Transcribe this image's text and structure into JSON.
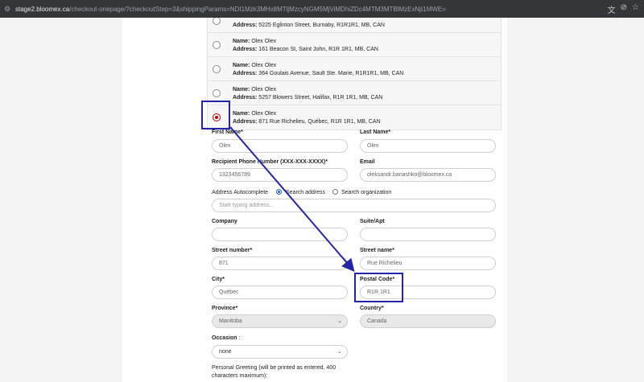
{
  "browser": {
    "url_host": "stage2.bloomex.ca",
    "url_path": "/checkout-onepage/?checkoutStep=3&shippingParams=NDI1Mzk3MHx8MTljMzcyNGM5MjViMDhiZDc4MTM3MTBlMzExNjI1MWE="
  },
  "addresses": [
    {
      "name_label": "",
      "name": "",
      "address_label": "Address:",
      "address": "5225 Eglinton Street, Burnaby, R1R1R1, MB, CAN"
    },
    {
      "name_label": "Name:",
      "name": "Olex Olex",
      "address_label": "Address:",
      "address": "161 Beacon St, Saint John, R1R 1R1, MB, CAN"
    },
    {
      "name_label": "Name:",
      "name": "Olex Olex",
      "address_label": "Address:",
      "address": "364 Goulais Avenue, Sault Ste. Marie, R1R1R1, MB, CAN"
    },
    {
      "name_label": "Name:",
      "name": "Olex Olex",
      "address_label": "Address:",
      "address": "5257 Blowers Street, Halifax, R1R 1R1, MB, CAN"
    },
    {
      "name_label": "Name:",
      "name": "Olex Olex",
      "address_label": "Address:",
      "address": "871 Rue Richelieu, Québec, R1R 1R1, MB, CAN"
    }
  ],
  "form": {
    "first_name_label": "First Name*",
    "first_name": "Olex",
    "last_name_label": "Last Name*",
    "last_name": "Olex",
    "phone_label": "Recipient Phone Number (XXX-XXX-XXXX)*",
    "phone": "1323456789",
    "email_label": "Email",
    "email": "oleksandr.banashko@bloomex.ca",
    "autocomplete_label": "Address Autocomplete",
    "search_address": "Search address",
    "search_org": "Search organization",
    "autocomplete_placeholder": "Start typing address...",
    "company_label": "Company",
    "suite_label": "Suite/Apt",
    "street_number_label": "Street number*",
    "street_number": "871",
    "street_name_label": "Street name*",
    "street_name": "Rue Richelieu",
    "city_label": "City*",
    "city": "Québec",
    "postal_label": "Postal Code*",
    "postal": "R1R 1R1",
    "province_label": "Province*",
    "province": "Manitoba",
    "country_label": "Country*",
    "country": "Canada",
    "occasion_label": "Occasion",
    "occasion_colon": ":",
    "occasion": "none",
    "greeting_label_1": "Personal Greeting (will be printed as entered, 400",
    "greeting_label_2": "characters maximum):"
  },
  "annotation_color": "#2424a6"
}
